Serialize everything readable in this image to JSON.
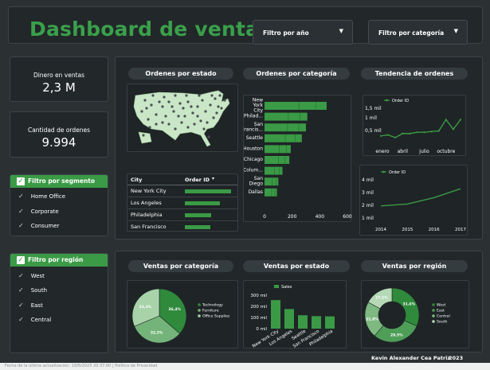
{
  "header": {
    "title": "Dashboard de ventas",
    "filter_year": "Filtro por año",
    "filter_category": "Filtro por categoría"
  },
  "kpis": {
    "sales_label": "Dinero en ventas",
    "sales_value": "2,3 M",
    "orders_label": "Cantidad de ordenes",
    "orders_value": "9.994"
  },
  "segment_filter": {
    "title": "Filtro por segmento",
    "items": [
      "Home Office",
      "Corporate",
      "Consumer"
    ]
  },
  "region_filter": {
    "title": "Filtro por región",
    "items": [
      "West",
      "South",
      "East",
      "Central"
    ]
  },
  "sections": {
    "orders_by_state": "Ordenes por estado",
    "orders_by_category": "Ordenes por categoría",
    "orders_trend": "Tendencia de ordenes",
    "sales_by_category": "Ventas por categoría",
    "sales_by_state": "Ventas por estado",
    "sales_by_region": "Ventas por región"
  },
  "city_table": {
    "col_city": "City",
    "col_order": "Order ID",
    "sort_icon": "sort-desc-icon",
    "rows": [
      {
        "city": "New York City",
        "value": 0.9
      },
      {
        "city": "Los Angeles",
        "value": 0.68
      },
      {
        "city": "Philadelphia",
        "value": 0.52
      },
      {
        "city": "San Francisco",
        "value": 0.5
      }
    ]
  },
  "footer": {
    "author": "Kevin Alexander Cea Patriz",
    "year": "2023",
    "caption": "Fecha de la última actualización: 19/6/2023 20:37:00 | Política de Privacidad"
  },
  "colors": {
    "accent": "#3a9a45",
    "background": "#2b3032",
    "panel": "#22272a"
  },
  "chart_data": [
    {
      "type": "bar",
      "title": "Ordenes por categoría",
      "orientation": "horizontal",
      "categories": [
        "New York City",
        "Philadelphia",
        "San Francisco",
        "Seattle",
        "Houston",
        "Chicago",
        "Columbus",
        "San Diego",
        "Dallas"
      ],
      "values": [
        450,
        310,
        300,
        270,
        190,
        180,
        130,
        100,
        90
      ],
      "xticks": [
        "0",
        "200",
        "400",
        "600"
      ],
      "xlim": [
        0,
        600
      ]
    },
    {
      "type": "line",
      "title": "",
      "legend": "Order ID",
      "categories": [
        "enero",
        "",
        "",
        "abril",
        "",
        "",
        "julio",
        "",
        "",
        "octubre",
        "",
        ""
      ],
      "values": [
        620,
        650,
        570,
        690,
        690,
        730,
        730,
        750,
        770,
        1110,
        820,
        1110
      ],
      "yticks": [
        "1,5 mil",
        "1 mil",
        "0,5 mil"
      ],
      "ylim": [
        400,
        1500
      ]
    },
    {
      "type": "line",
      "title": "",
      "legend": "Order ID",
      "categories": [
        "2014",
        "2015",
        "2016",
        "2017"
      ],
      "values": [
        1.95,
        2.1,
        2.6,
        3.3
      ],
      "yticks": [
        "4 mil",
        "3 mil",
        "2 mil",
        "1 mil"
      ],
      "ylim": [
        1,
        4
      ]
    },
    {
      "type": "pie",
      "title": "Ventas por categoría",
      "labels": [
        "Technology",
        "Furniture",
        "Office Supplies"
      ],
      "values": [
        36.4,
        32.3,
        31.3
      ],
      "value_labels": [
        "36,4%",
        "32,3%",
        "31,3%"
      ],
      "colors": [
        "#2f8a3c",
        "#74b47a",
        "#a8d3a9"
      ]
    },
    {
      "type": "bar",
      "title": "Ventas por estado",
      "legend": "Sales",
      "categories": [
        "New York City",
        "Los Angeles",
        "Seattle",
        "San Francisco",
        "Philadelphia"
      ],
      "values": [
        256,
        176,
        120,
        112,
        110
      ],
      "yticks": [
        "300 mil",
        "200 mil",
        "100 mil",
        "0 mil"
      ],
      "ylim": [
        0,
        300
      ]
    },
    {
      "type": "pie",
      "title": "Ventas por región",
      "donut": true,
      "labels": [
        "West",
        "East",
        "Central",
        "South"
      ],
      "values": [
        31.6,
        29.5,
        21.8,
        17.1
      ],
      "value_labels": [
        "31,6%",
        "29,5%",
        "21,8%",
        "17,1%"
      ],
      "colors": [
        "#2f8a3c",
        "#4f9e58",
        "#7db981",
        "#b5d9b6"
      ]
    }
  ]
}
